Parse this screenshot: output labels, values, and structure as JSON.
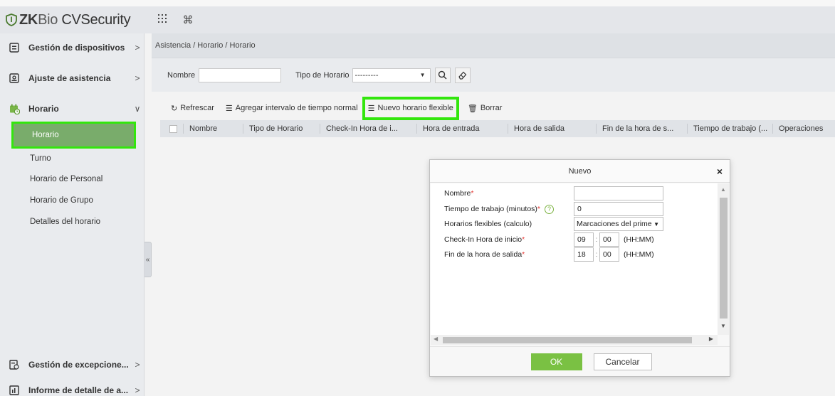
{
  "app": {
    "logo_zk": "ZK",
    "logo_bio": "Bio",
    "logo_rest": " CVSecurity",
    "header_icons": [
      "apps-grid-icon",
      "command-icon"
    ]
  },
  "sidebar": {
    "items": [
      {
        "label": "Gestión de dispositivos",
        "icon": "device-icon",
        "arrow": ">"
      },
      {
        "label": "Ajuste de asistencia",
        "icon": "attendance-settings-icon",
        "arrow": ">"
      },
      {
        "label": "Horario",
        "icon": "schedule-icon",
        "arrow": "∨"
      }
    ],
    "sub_items": [
      "Horario",
      "Turno",
      "Horario de Personal",
      "Horario de Grupo",
      "Detalles del horario"
    ],
    "bottom_items": [
      {
        "label": "Gestión de excepcione...",
        "icon": "exception-icon",
        "arrow": ">"
      },
      {
        "label": "Informe de detalle de a...",
        "icon": "report-icon",
        "arrow": ">"
      }
    ],
    "collapse_glyph": "«"
  },
  "breadcrumb": "Asistencia / Horario / Horario",
  "search": {
    "nombre_label": "Nombre",
    "nombre_value": "",
    "tipo_label": "Tipo de Horario",
    "tipo_value": "---------"
  },
  "toolbar": {
    "refresh": "Refrescar",
    "add_normal": "Agregar intervalo de tiempo normal",
    "new_flexible": "Nuevo horario flexible",
    "delete": "Borrar"
  },
  "table": {
    "columns": [
      "Nombre",
      "Tipo de Horario",
      "Check-In Hora de i...",
      "Hora de entrada",
      "Hora de salida",
      "Fin de la hora de s...",
      "Tiempo de trabajo (...",
      "Operaciones"
    ]
  },
  "dialog": {
    "title": "Nuevo",
    "close": "×",
    "fields": {
      "nombre_label": "Nombre",
      "nombre_value": "",
      "tiempo_label": "Tiempo de trabajo (minutos)",
      "tiempo_value": "0",
      "flex_label": "Horarios flexibles (calculo)",
      "flex_value": "Marcaciones del primer",
      "checkin_label": "Check-In Hora de inicio",
      "checkin_hh": "09",
      "checkin_mm": "00",
      "fin_label": "Fin de la hora de salida",
      "fin_hh": "18",
      "fin_mm": "00",
      "time_hint": "(HH:MM)",
      "required_mark": "*",
      "help_glyph": "?",
      "time_sep": ":"
    },
    "ok": "OK",
    "cancel": "Cancelar"
  },
  "colors": {
    "highlight": "#33e60d",
    "active_menu": "#79ac6b",
    "ok_button": "#7ac143"
  }
}
